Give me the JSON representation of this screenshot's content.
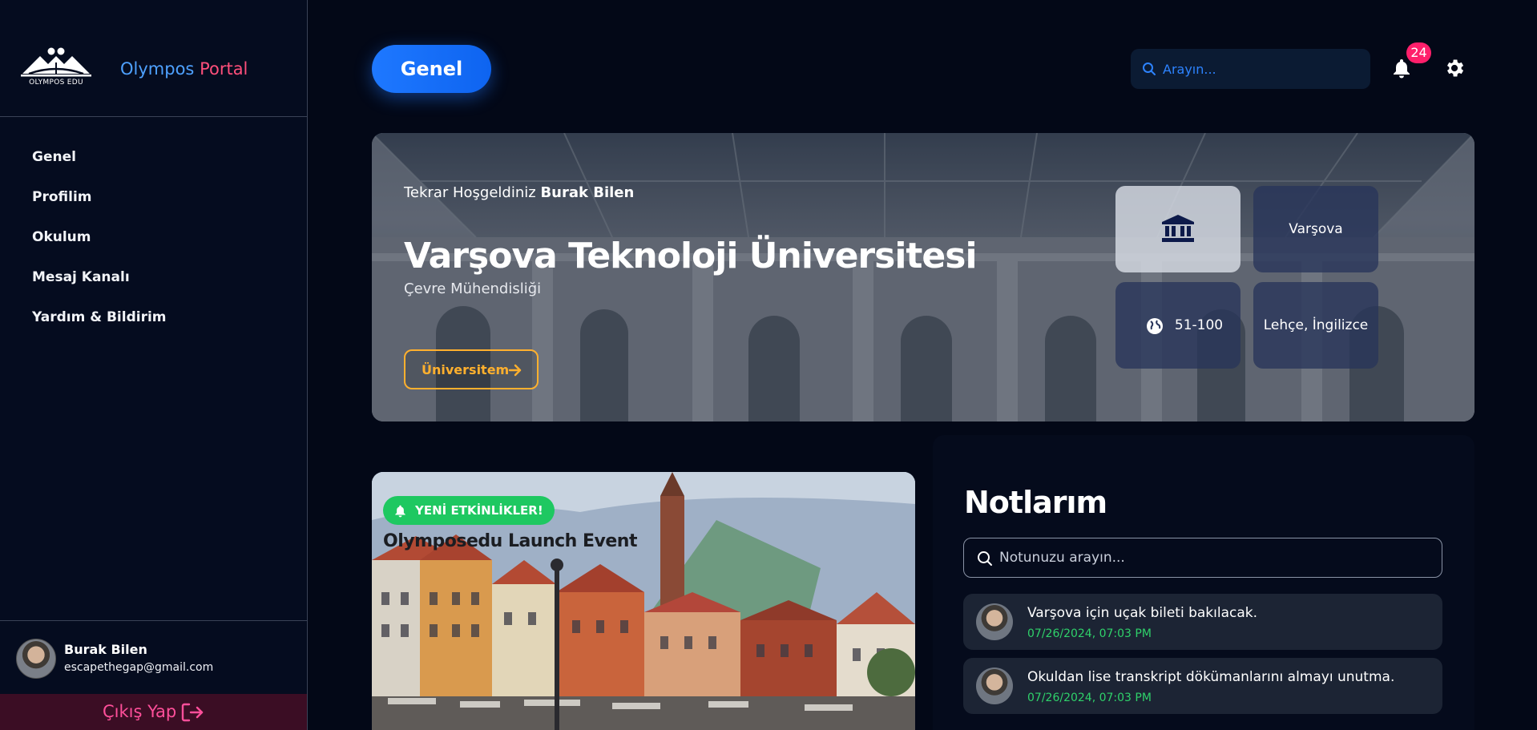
{
  "sidebar": {
    "logo_text": "OLYMPOS EDU",
    "brand": {
      "part1": "Olympos",
      "part2": "Portal"
    },
    "nav": [
      {
        "label": "Genel"
      },
      {
        "label": "Profilim"
      },
      {
        "label": "Okulum"
      },
      {
        "label": "Mesaj Kanalı"
      },
      {
        "label": "Yardım & Bildirim"
      }
    ],
    "user": {
      "name": "Burak Bilen",
      "email": "escapethegap@gmail.com"
    },
    "logout_label": "Çıkış Yap"
  },
  "header": {
    "page_button": "Genel",
    "search_placeholder": "Arayın...",
    "notification_count": "24"
  },
  "hero": {
    "welcome_prefix": "Tekrar Hoşgeldiniz",
    "welcome_name": "Burak Bilen",
    "university": "Varşova Teknoloji Üniversitesi",
    "department": "Çevre Mühendisliği",
    "button_label": "Üniversitem",
    "tiles": {
      "city": "Varşova",
      "ranking": "51-100",
      "languages": "Lehçe, İngilizce"
    }
  },
  "event": {
    "badge": "YENİ ETKİNLİKLER!",
    "title": "Olymposedu Launch Event"
  },
  "notes": {
    "title": "Notlarım",
    "search_placeholder": "Notunuzu arayın...",
    "items": [
      {
        "text": "Varşova için uçak bileti bakılacak.",
        "date": "07/26/2024, 07:03 PM"
      },
      {
        "text": "Okuldan lise transkript dökümanlarını almayı unutma.",
        "date": "07/26/2024, 07:03 PM"
      }
    ]
  },
  "colors": {
    "background": "#030817",
    "primary_blue": "#1e78ff",
    "brand_pink": "#ff4f7b",
    "accent_orange": "#ffb02e",
    "success_green": "#1ec861",
    "badge_red": "#ff1f6b"
  },
  "icons": [
    "logo-icon",
    "search-icon",
    "bell-icon",
    "gear-icon",
    "bank-icon",
    "globe-icon",
    "arrow-right-icon",
    "logout-icon"
  ]
}
